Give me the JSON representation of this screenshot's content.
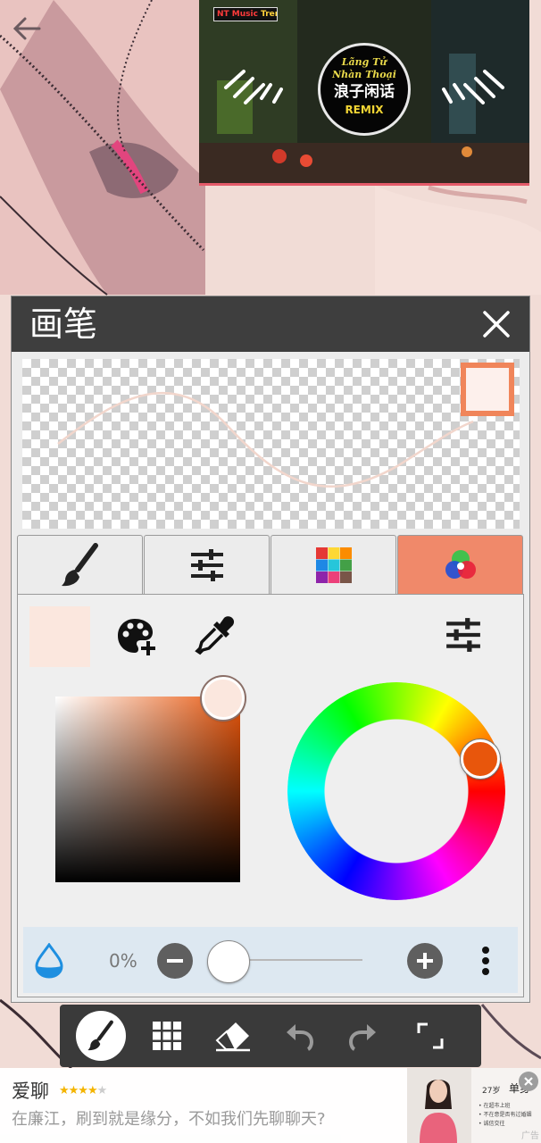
{
  "panel": {
    "title": "画笔",
    "close_icon": "close-icon",
    "selected_color": "#fbe7de",
    "hue_color": "#e8560c",
    "preview_frame_color": "#f0855a"
  },
  "tabs": [
    {
      "icon": "brush-icon",
      "active": false
    },
    {
      "icon": "sliders-icon",
      "active": false
    },
    {
      "icon": "palette-grid-icon",
      "active": false
    },
    {
      "icon": "color-circles-icon",
      "active": true,
      "color": "#f0896a"
    }
  ],
  "color_tools": {
    "add_palette_icon": "palette-add-icon",
    "eyedropper_icon": "eyedropper-icon",
    "settings_icon": "sliders-icon"
  },
  "opacity": {
    "value_label": "0%",
    "level": 0,
    "decrease_icon": "minus-icon",
    "increase_icon": "plus-icon",
    "more_icon": "more-vertical-icon",
    "drop_icon": "water-drop-icon"
  },
  "toolbar": {
    "tools": [
      "brush-icon",
      "grid-icon",
      "eraser-icon",
      "undo-icon",
      "redo-icon",
      "fullscreen-icon"
    ]
  },
  "video": {
    "logo": "NT Music",
    "logo_accent": "Trends",
    "line1": "Lãng Tử",
    "line2": "Nhàn Thoại",
    "title": "浪子闲话",
    "tag": "REMIX"
  },
  "ad": {
    "name": "爱聊",
    "stars": "★★★★",
    "stars_off": "★",
    "text": "在廉江，刷到就是缘分，不如我们先聊聊天?",
    "age": "27岁",
    "single": "单身",
    "lines": [
      "• 在超市上班",
      "• 不在意是否有过婚姻",
      "• 诚信交往"
    ],
    "label": "广告"
  }
}
